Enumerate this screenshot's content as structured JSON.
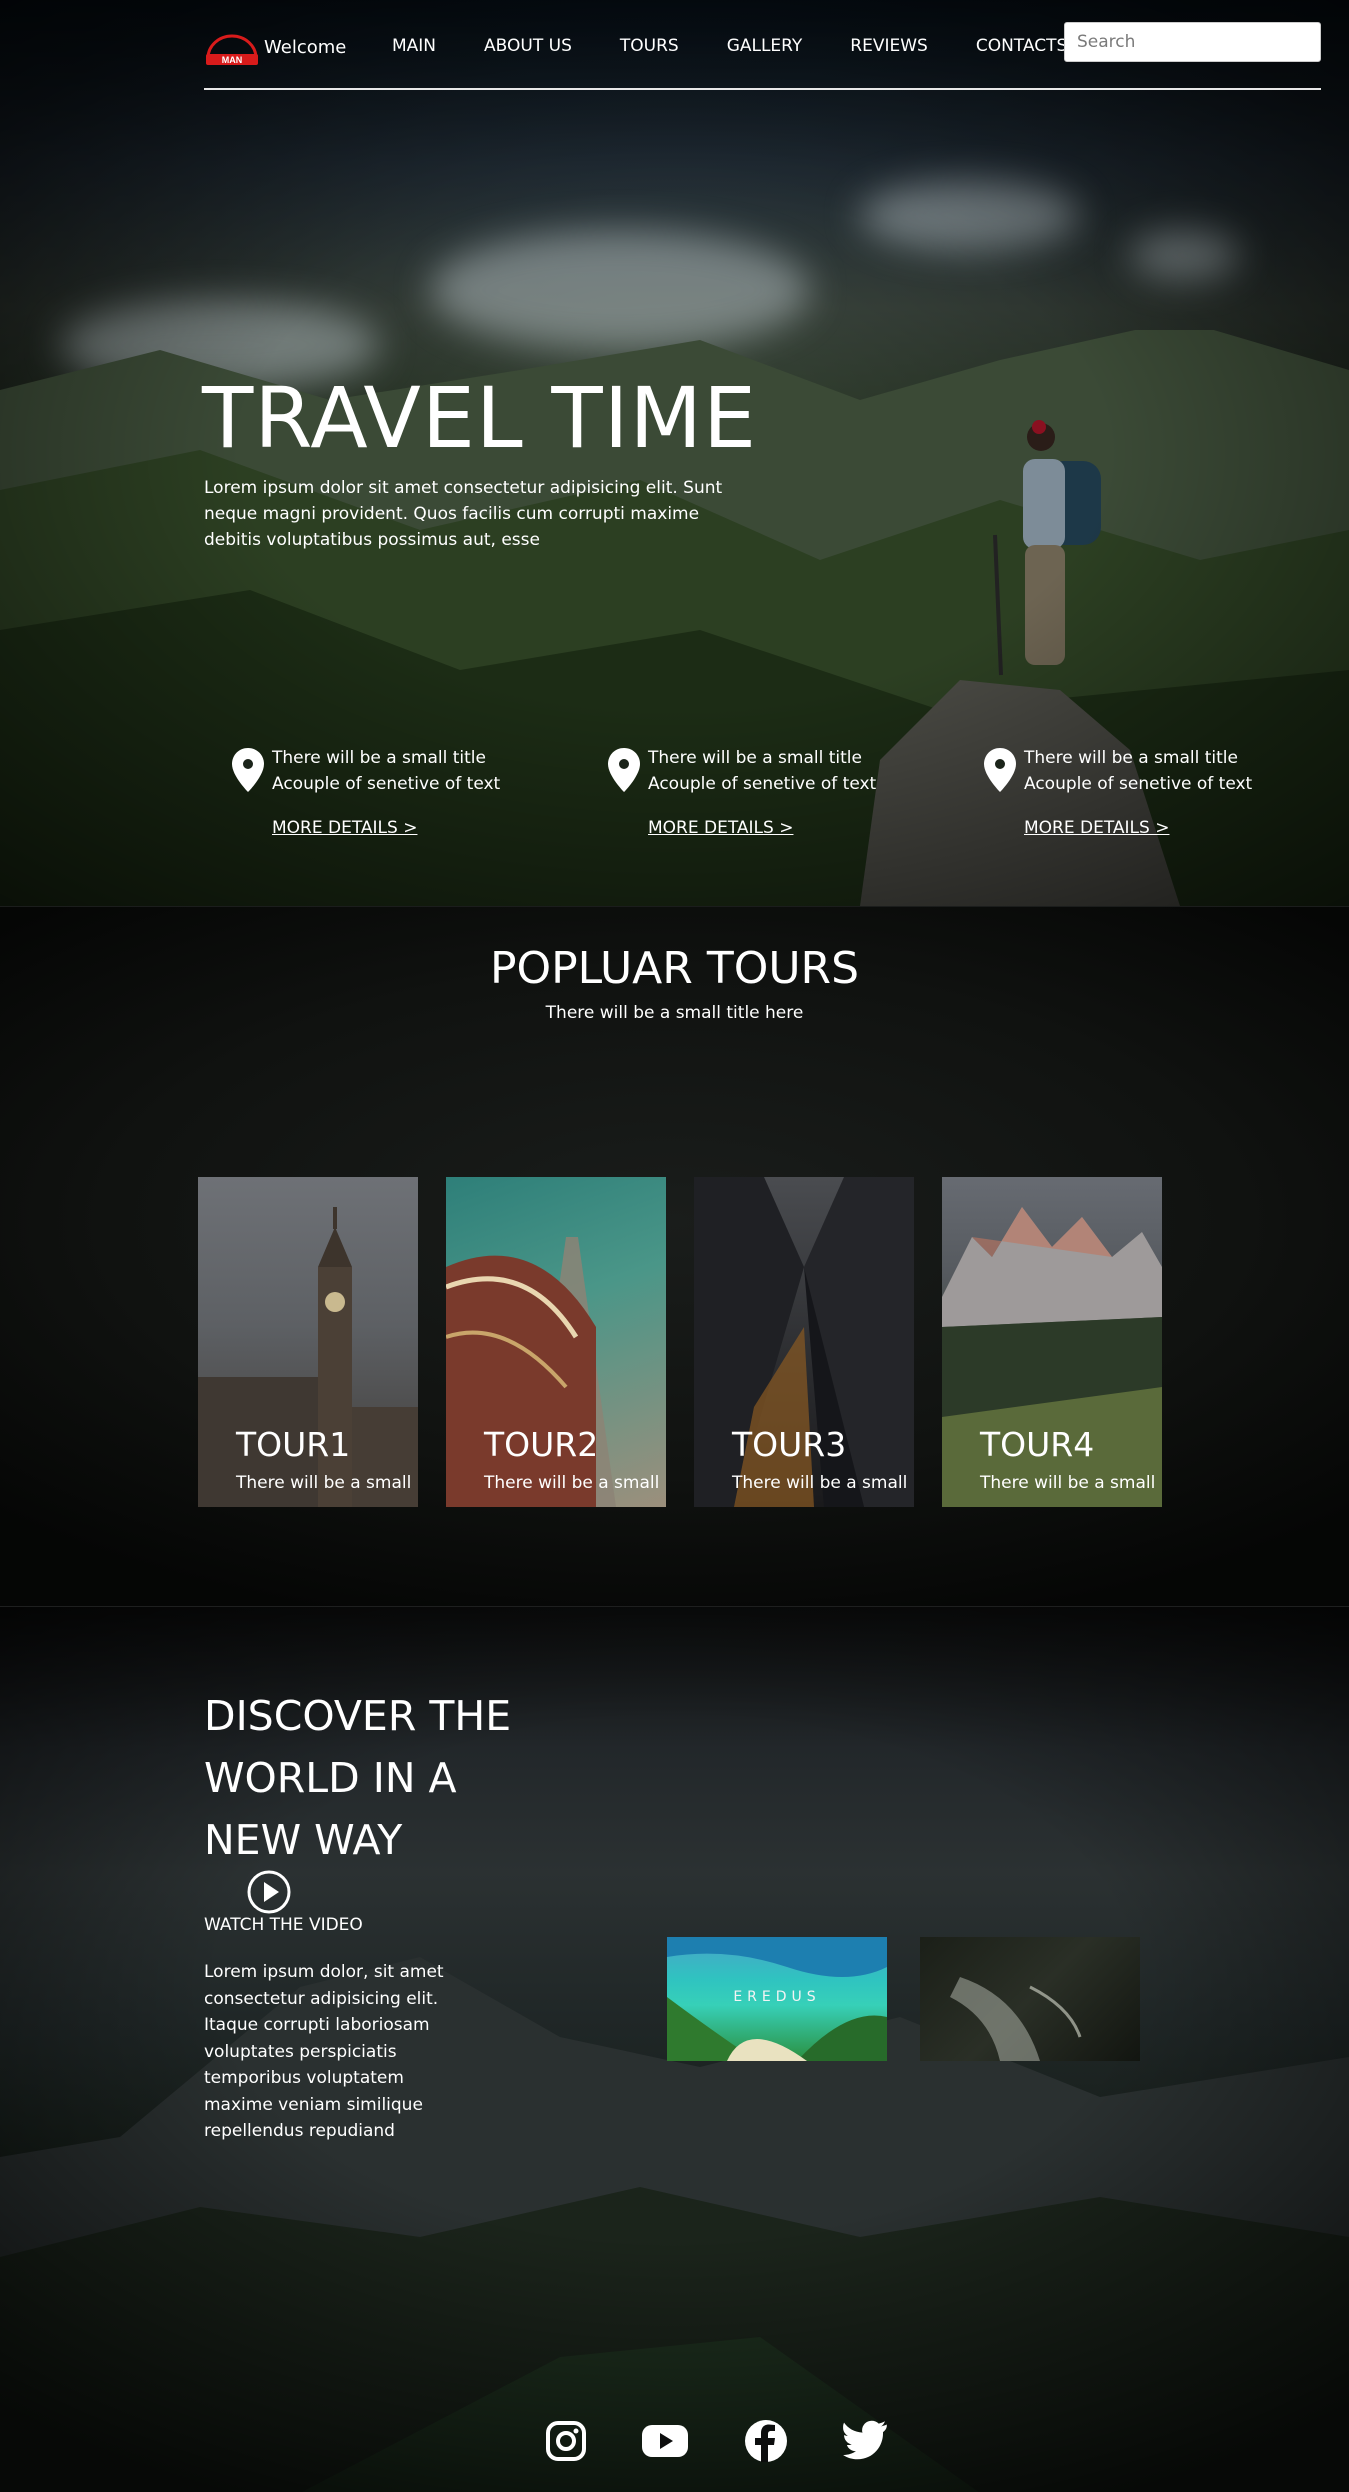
{
  "header": {
    "logo_text": "MAN",
    "welcome": "Welcome",
    "nav": [
      "MAIN",
      "ABOUT US",
      "TOURS",
      "GALLERY",
      "REVIEWS",
      "CONTACTS"
    ],
    "search_placeholder": "Search"
  },
  "hero": {
    "title": "TRAVEL TIME",
    "text": "Lorem ipsum dolor sit amet consectetur adipisicing elit. Sunt neque magni provident. Quos facilis cum corrupti maxime debitis voluptatibus possimus aut, esse",
    "features": [
      {
        "title": "There will be a small title",
        "text": "Acouple of senetive of text",
        "link": "MORE DETAILS >"
      },
      {
        "title": "There will be a small title",
        "text": "Acouple of senetive of text",
        "link": "MORE DETAILS >"
      },
      {
        "title": "There will be a small title",
        "text": "Acouple of senetive of text",
        "link": "MORE DETAILS >"
      }
    ]
  },
  "popular": {
    "title": "POPLUAR TOURS",
    "subtitle": "There will be a small title here",
    "tours": [
      {
        "name": "TOUR1",
        "text": "There will be a small"
      },
      {
        "name": "TOUR2",
        "text": "There will be a small"
      },
      {
        "name": "TOUR3",
        "text": "There will be a small"
      },
      {
        "name": "TOUR4",
        "text": "There will be a small"
      }
    ]
  },
  "discover": {
    "title": "DISCOVER THE WORLD IN A NEW WAY",
    "watch_label": "WATCH THE VIDEO",
    "text": "Lorem ipsum dolor, sit amet consectetur adipisicing elit. Itaque corrupti laboriosam voluptates perspiciatis temporibus voluptatem maxime veniam similique repellendus repudiand",
    "thumbs": [
      {
        "label": "EREDUS"
      },
      {
        "label": ""
      }
    ]
  },
  "social": [
    "instagram-icon",
    "youtube-icon",
    "facebook-icon",
    "twitter-icon"
  ],
  "colors": {
    "logo_red": "#d81b1b",
    "background": "#0c0d0d",
    "text": "#ffffff"
  }
}
